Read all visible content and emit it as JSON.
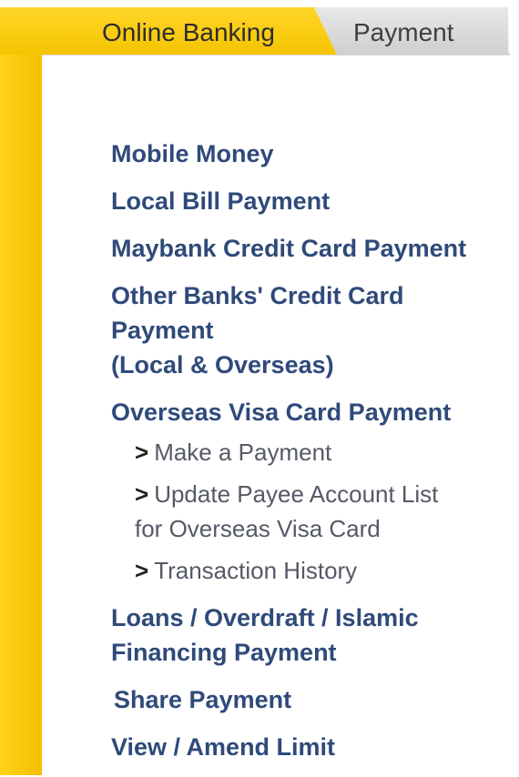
{
  "tabs": {
    "online_banking": "Online Banking",
    "payment": "Payment"
  },
  "menu": {
    "mobile_money": "Mobile Money",
    "local_bill_payment": "Local Bill Payment",
    "maybank_cc_payment": "Maybank Credit Card Payment",
    "other_banks_line1": "Other Banks' Credit Card",
    "other_banks_line2": "Payment",
    "other_banks_line3": "(Local & Overseas)",
    "overseas_visa": "Overseas Visa Card Payment",
    "sub_arrow": ">",
    "make_payment": "Make a Payment",
    "update_payee_line1": "Update Payee Account List",
    "update_payee_line2": "for Overseas Visa Card",
    "transaction_history": "Transaction History",
    "loans_line1": "Loans / Overdraft / Islamic",
    "loans_line2": "Financing Payment",
    "share_payment": "Share Payment",
    "view_amend_limit": "View / Amend Limit"
  },
  "colors": {
    "accent_yellow": "#f5c400",
    "link_blue": "#2f4a7a",
    "sub_link_gray": "#555a66"
  }
}
